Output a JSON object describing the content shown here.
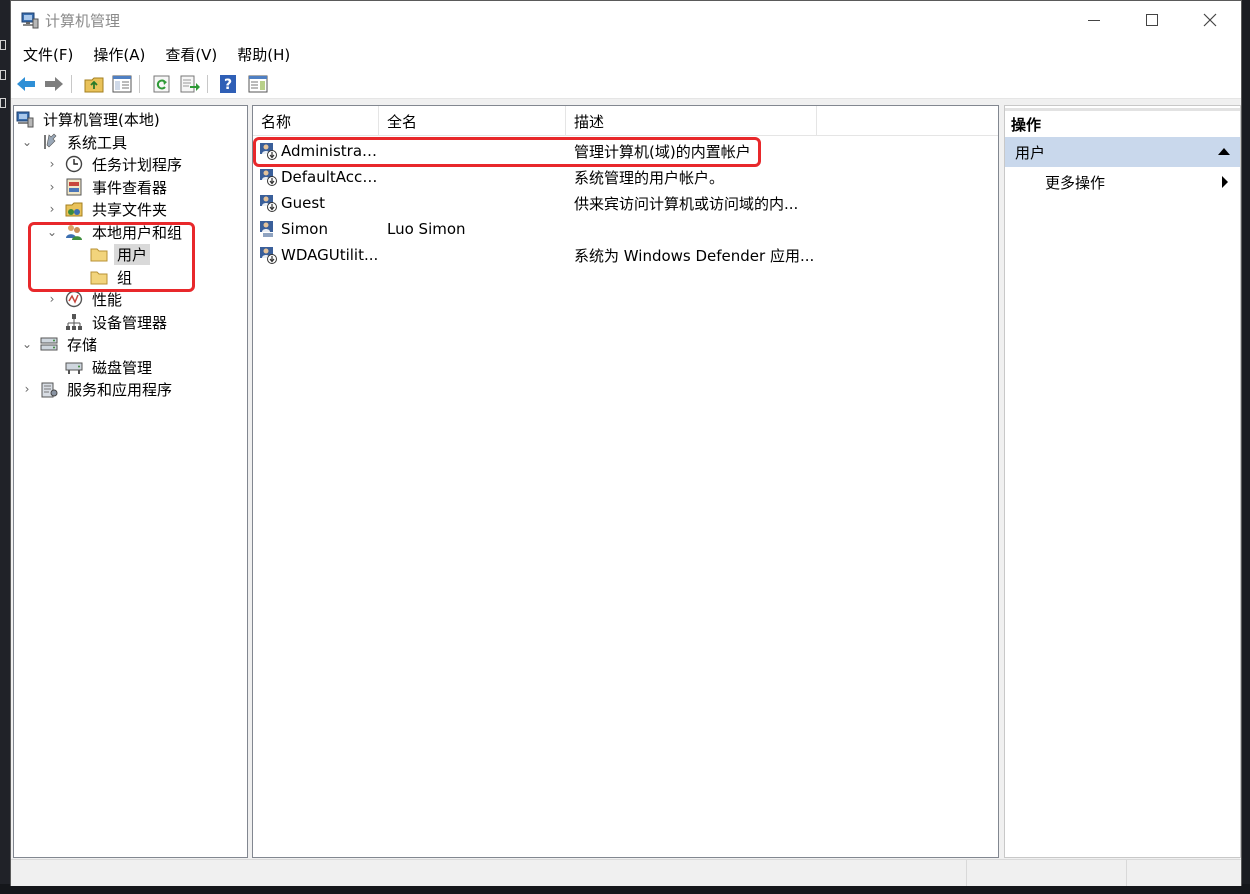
{
  "window": {
    "title": "计算机管理"
  },
  "menu": [
    "文件(F)",
    "操作(A)",
    "查看(V)",
    "帮助(H)"
  ],
  "toolbar": [
    "back-icon",
    "forward-icon",
    "up-folder-icon",
    "show-tree-icon",
    "refresh-icon",
    "export-list-icon",
    "help-icon",
    "show-action-pane-icon"
  ],
  "tree": {
    "root": "计算机管理(本地)",
    "items": [
      {
        "label": "系统工具",
        "expander": "⌄"
      },
      {
        "label": "任务计划程序",
        "expander": "›"
      },
      {
        "label": "事件查看器",
        "expander": "›"
      },
      {
        "label": "共享文件夹",
        "expander": "›"
      },
      {
        "label": "本地用户和组",
        "expander": "⌄"
      },
      {
        "label": "用户",
        "expander": ""
      },
      {
        "label": "组",
        "expander": ""
      },
      {
        "label": "性能",
        "expander": "›"
      },
      {
        "label": "设备管理器",
        "expander": ""
      },
      {
        "label": "存储",
        "expander": "⌄"
      },
      {
        "label": "磁盘管理",
        "expander": ""
      },
      {
        "label": "服务和应用程序",
        "expander": "›"
      }
    ]
  },
  "list": {
    "columns": [
      "名称",
      "全名",
      "描述"
    ],
    "rows": [
      {
        "name": "Administrator",
        "full_name": "",
        "description": "管理计算机(域)的内置帐户"
      },
      {
        "name": "DefaultAcco...",
        "full_name": "",
        "description": "系统管理的用户帐户。"
      },
      {
        "name": "Guest",
        "full_name": "",
        "description": "供来宾访问计算机或访问域的内..."
      },
      {
        "name": "Simon",
        "full_name": "Luo Simon",
        "description": ""
      },
      {
        "name": "WDAGUtilit...",
        "full_name": "",
        "description": "系统为 Windows Defender 应用..."
      }
    ]
  },
  "actions": {
    "header": "操作",
    "group": "用户",
    "items": [
      "更多操作"
    ]
  },
  "colors": {
    "highlight": "#e8282b",
    "selection": "#d9d9d9",
    "action_group": "#c9d8ec"
  }
}
